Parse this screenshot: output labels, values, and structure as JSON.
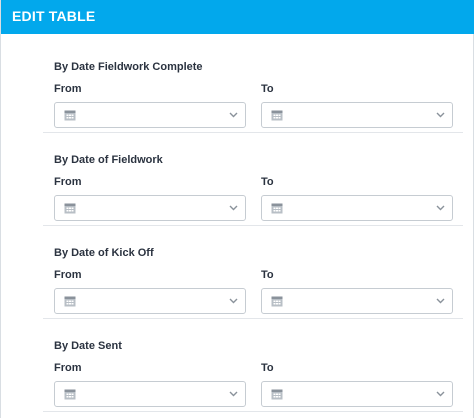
{
  "header": {
    "title": "EDIT TABLE"
  },
  "colors": {
    "header_bg": "#02a8ec",
    "border": "#c6ccd2",
    "icon": "#8a929b"
  },
  "icons": {
    "calendar": "calendar-icon",
    "chevron": "chevron-down-icon"
  },
  "sections": [
    {
      "title": "By Date Fieldwork Complete",
      "from_label": "From",
      "to_label": "To",
      "from_value": "",
      "to_value": ""
    },
    {
      "title": "By Date of Fieldwork",
      "from_label": "From",
      "to_label": "To",
      "from_value": "",
      "to_value": ""
    },
    {
      "title": "By Date of Kick Off",
      "from_label": "From",
      "to_label": "To",
      "from_value": "",
      "to_value": ""
    },
    {
      "title": "By Date Sent",
      "from_label": "From",
      "to_label": "To",
      "from_value": "",
      "to_value": ""
    }
  ]
}
